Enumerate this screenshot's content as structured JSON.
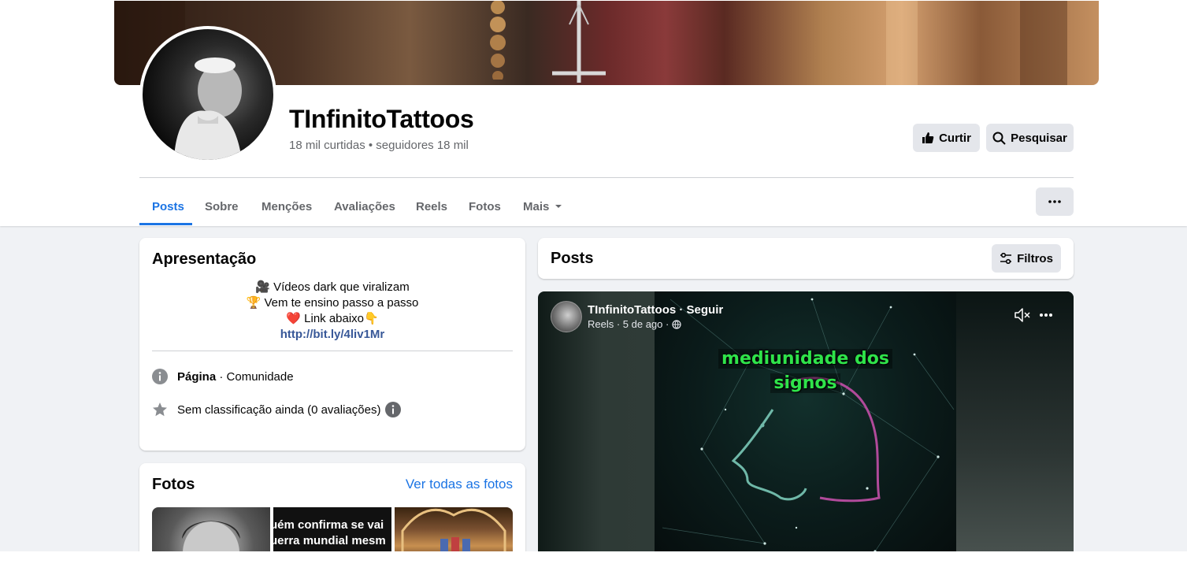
{
  "page": {
    "name": "TInfinitoTattoos",
    "stats": "18 mil curtidas • seguidores 18 mil"
  },
  "actions": {
    "like_label": "Curtir",
    "search_label": "Pesquisar"
  },
  "tabs": [
    {
      "label": "Posts",
      "active": true
    },
    {
      "label": "Sobre"
    },
    {
      "label": "Menções"
    },
    {
      "label": "Avaliações"
    },
    {
      "label": "Reels"
    },
    {
      "label": "Fotos"
    },
    {
      "label": "Mais"
    }
  ],
  "intro": {
    "title": "Apresentação",
    "bio": [
      {
        "emoji": "🎥",
        "text": "Vídeos dark que viralizam"
      },
      {
        "emoji": "🏆",
        "text": "Vem te ensino passo a passo"
      },
      {
        "emoji": "❤️",
        "text": "Link abaixo👇"
      }
    ],
    "link": "http://bit.ly/4liv1Mr",
    "category_label": "Página",
    "category_value": " · Comunidade",
    "rating": "Sem classificação ainda (0 avaliações)"
  },
  "photos": {
    "title": "Fotos",
    "see_all": "Ver todas as fotos",
    "thumb2_lines": [
      "uém confirma se vai",
      "uerra mundial mesm"
    ]
  },
  "posts": {
    "title": "Posts",
    "filters_label": "Filtros"
  },
  "reel": {
    "author_line": "TInfinitoTattoos · Seguir",
    "meta": "Reels · 5 de ago ·",
    "caption_line1": "mediunidade dos",
    "caption_line2": "signos"
  },
  "colors": {
    "accent": "#1b74e4",
    "link": "#385898",
    "caption_green": "#2fe34a"
  }
}
